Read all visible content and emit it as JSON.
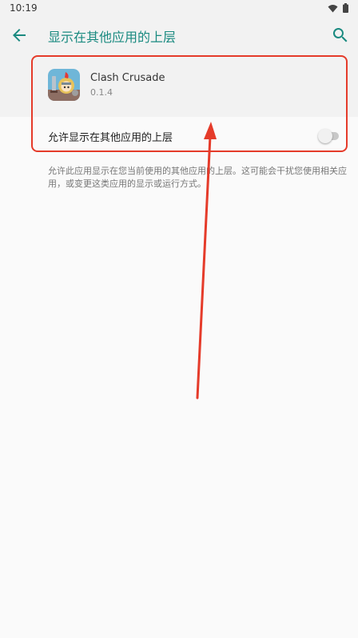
{
  "status_bar": {
    "time": "10:19",
    "icons": [
      "wifi-icon",
      "battery-icon"
    ]
  },
  "app_bar": {
    "title": "显示在其他应用的上层",
    "back_icon": "arrow-back-icon",
    "search_icon": "search-icon"
  },
  "app": {
    "name": "Clash Crusade",
    "version": "0.1.4",
    "icon": "knight-app-icon"
  },
  "setting": {
    "label": "允许显示在其他应用的上层",
    "enabled": false
  },
  "summary": "允许此应用显示在您当前使用的其他应用的上层。这可能会干扰您使用相关应用，或变更这类应用的显示或运行方式。",
  "colors": {
    "accent": "#1a8a80",
    "annotation": "#e53b2a",
    "background": "#fafafa",
    "header_background": "#f2f2f2"
  }
}
